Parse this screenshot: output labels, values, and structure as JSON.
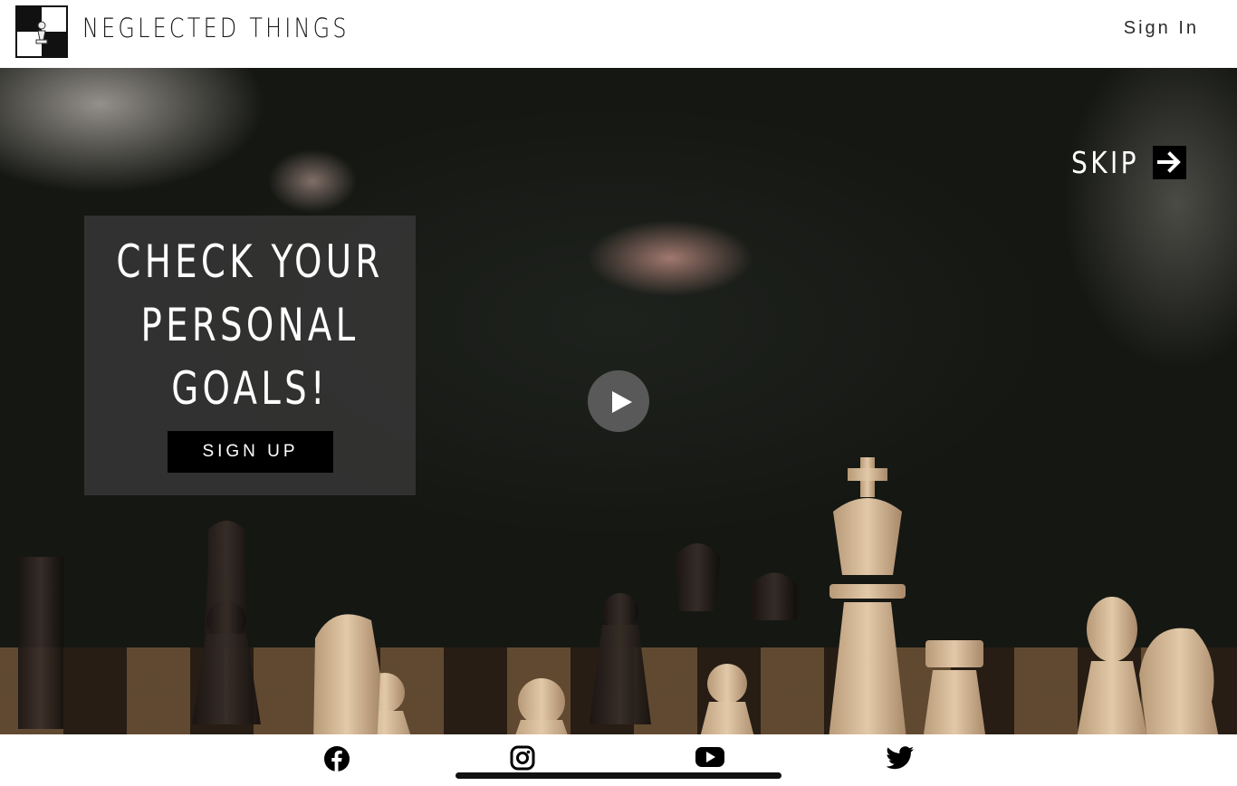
{
  "header": {
    "brand": "NEGLECTED THINGS",
    "logo_icon": "chess-checkerboard-logo-icon",
    "sign_in_label": "Sign In"
  },
  "hero": {
    "background": "chess-board-photo",
    "skip_label": "SKIP",
    "skip_icon": "arrow-right-icon",
    "play_icon": "play-icon",
    "card": {
      "title": "CHECK YOUR\nPERSONAL\nGOALS!",
      "button_label": "SIGN UP"
    }
  },
  "footer": {
    "social": [
      {
        "name": "facebook",
        "icon": "facebook-icon"
      },
      {
        "name": "instagram",
        "icon": "instagram-icon"
      },
      {
        "name": "youtube",
        "icon": "youtube-icon"
      },
      {
        "name": "twitter",
        "icon": "twitter-icon"
      }
    ]
  },
  "colors": {
    "text_dark": "#1a1a1a",
    "button_bg": "#000000",
    "card_bg": "#3c3c3c"
  }
}
